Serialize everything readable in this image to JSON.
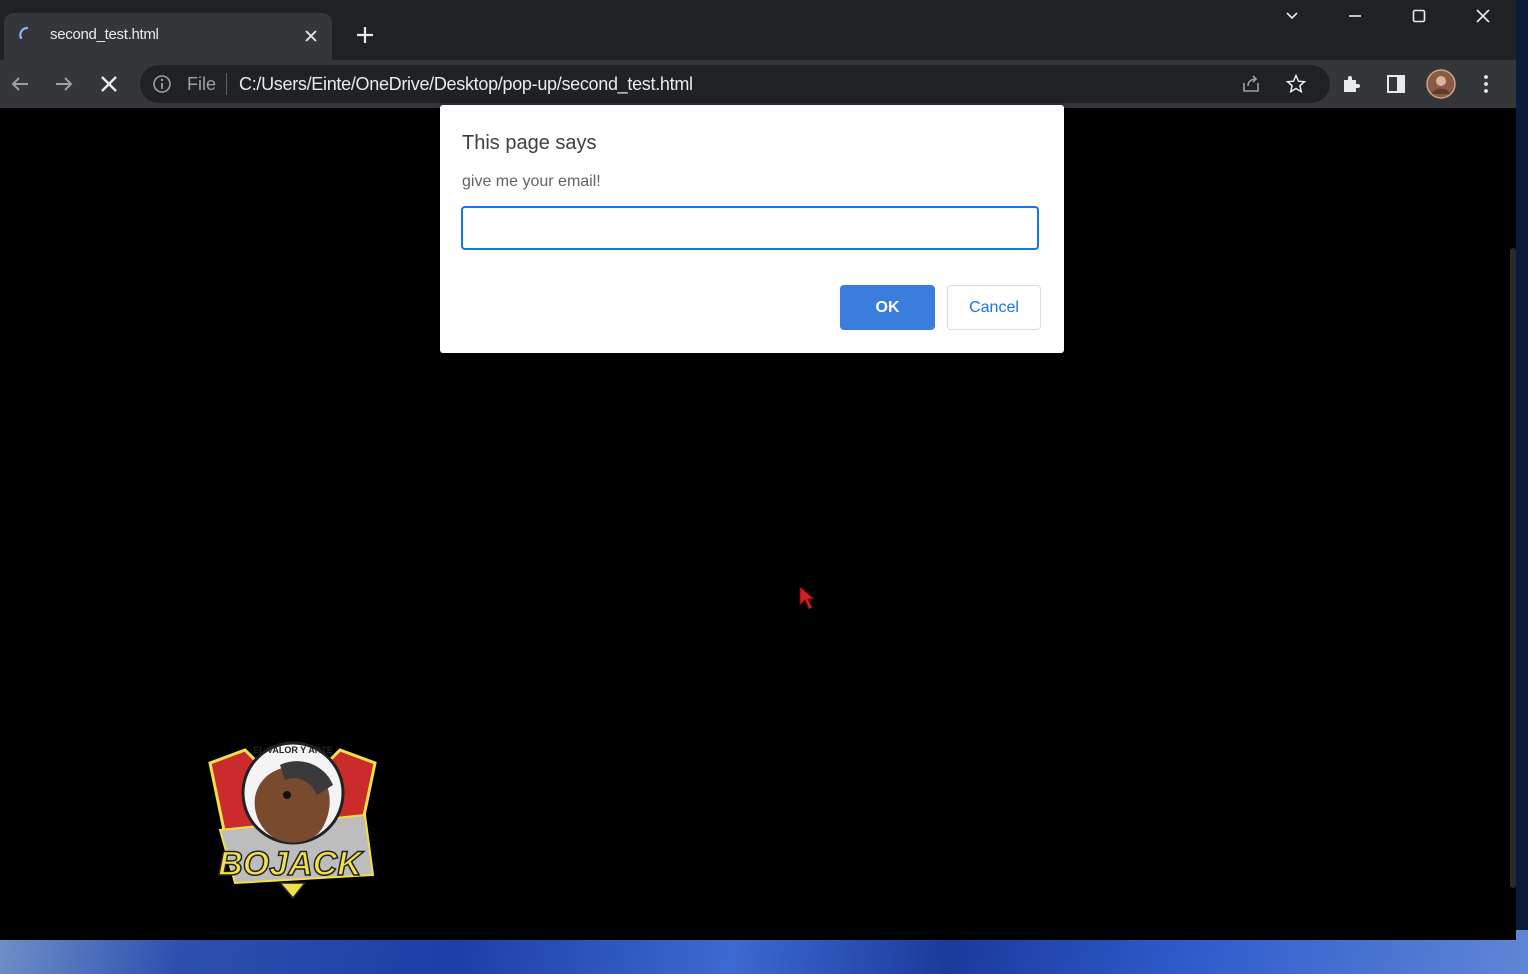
{
  "tab": {
    "title": "second_test.html",
    "favicon": "loading-spinner-icon"
  },
  "window_controls": [
    "chevron-down-icon",
    "minimize-icon",
    "maximize-icon",
    "close-icon"
  ],
  "toolbar": {
    "file_label": "File",
    "url": "C:/Users/Einte/OneDrive/Desktop/pop-up/second_test.html"
  },
  "dialog": {
    "title": "This page says",
    "message": "give me your email!",
    "input_value": "",
    "ok_label": "OK",
    "cancel_label": "Cancel"
  },
  "logo": {
    "text": "BOJACK",
    "arc_text": "EL VALOR Y ARTE"
  },
  "colors": {
    "accent": "#1a73e8",
    "ok_button": "#3b7ddd",
    "tab_bg": "#35363a",
    "frame_bg": "#202124"
  }
}
